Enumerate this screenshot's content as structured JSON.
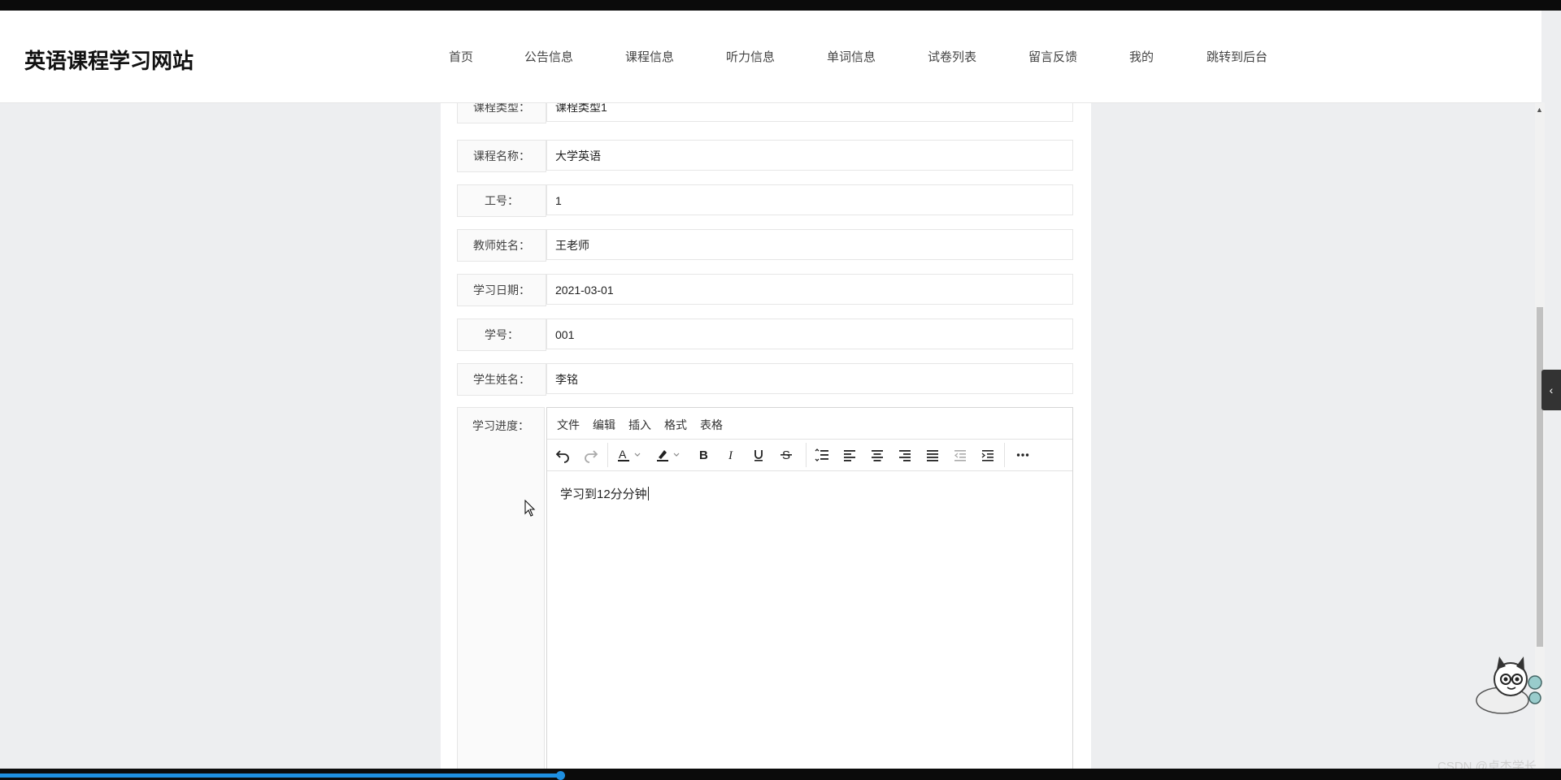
{
  "header": {
    "site_title": "英语课程学习网站",
    "nav": [
      "首页",
      "公告信息",
      "课程信息",
      "听力信息",
      "单词信息",
      "试卷列表",
      "留言反馈",
      "我的",
      "跳转到后台"
    ]
  },
  "form": {
    "rows": [
      {
        "label": "课程类型：",
        "value": "课程类型1"
      },
      {
        "label": "课程名称：",
        "value": "大学英语"
      },
      {
        "label": "工号：",
        "value": "1"
      },
      {
        "label": "教师姓名：",
        "value": "王老师"
      },
      {
        "label": "学习日期：",
        "value": "2021-03-01"
      },
      {
        "label": "学号：",
        "value": "001"
      },
      {
        "label": "学生姓名：",
        "value": "李铭"
      }
    ],
    "progress_label": "学习进度：",
    "editor": {
      "menu": [
        "文件",
        "编辑",
        "插入",
        "格式",
        "表格"
      ],
      "content": "学习到12分分钟",
      "toolbar_icons": [
        "undo-icon",
        "redo-icon",
        "font-color-icon",
        "dropdown-chevron-icon",
        "highlight-color-icon",
        "dropdown-chevron-icon",
        "bold-icon",
        "italic-icon",
        "underline-icon",
        "strikethrough-icon",
        "line-height-icon",
        "align-left-icon",
        "align-center-icon",
        "align-right-icon",
        "align-justify-icon",
        "outdent-icon",
        "indent-icon",
        "more-icon"
      ]
    }
  },
  "watermark": "CSDN @卓杰学长",
  "colors": {
    "accent_blue": "#1e8fe1",
    "page_bg": "#edeef0"
  }
}
